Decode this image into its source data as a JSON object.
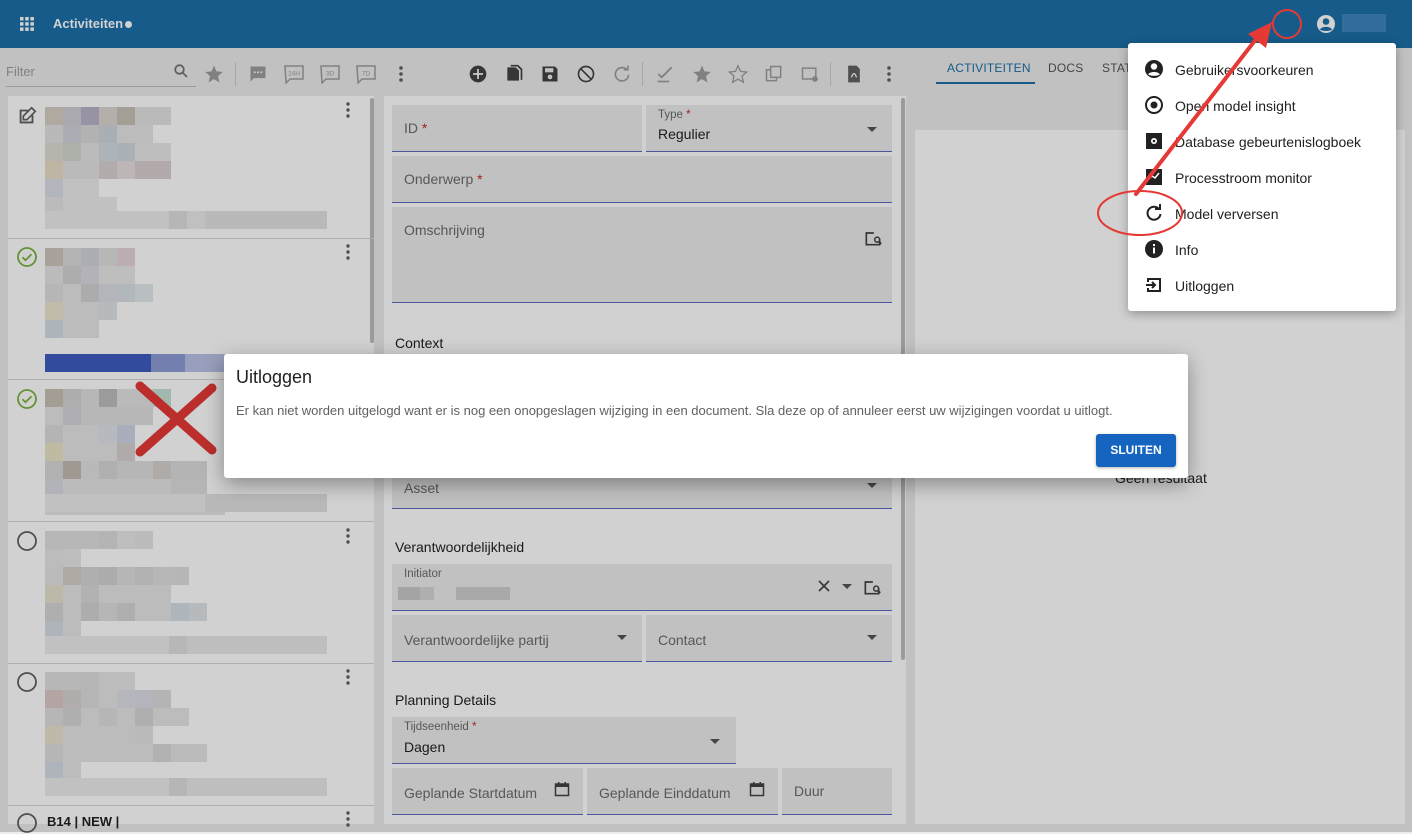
{
  "header": {
    "title": "Activiteiten"
  },
  "filter": {
    "placeholder": "Filter"
  },
  "tabs": [
    {
      "label": "ACTIVITEITEN",
      "active": true
    },
    {
      "label": "DOCS",
      "active": false
    },
    {
      "label": "STAT",
      "active": false
    }
  ],
  "list": {
    "last_item_text": "B14 | NEW |"
  },
  "form": {
    "id_label": "ID",
    "type_label": "Type",
    "type_value": "Regulier",
    "onderwerp_label": "Onderwerp",
    "omschrijving_label": "Omschrijving",
    "context_heading": "Context",
    "asset_label": "Asset",
    "verantwoordelijkheid_heading": "Verantwoordelijkheid",
    "initiator_label": "Initiator",
    "partij_label": "Verantwoordelijke partij",
    "contact_label": "Contact",
    "planning_heading": "Planning Details",
    "tijdseenheid_label": "Tijdseenheid",
    "tijdseenheid_value": "Dagen",
    "startdatum_label": "Geplande Startdatum",
    "einddatum_label": "Geplande Einddatum",
    "duur_label": "Duur",
    "required_mark": "*"
  },
  "right_panel": {
    "empty_text": "Geen resultaat"
  },
  "user_menu": {
    "items": [
      {
        "label": "Gebruikersvoorkeuren",
        "icon": "account-circle-icon"
      },
      {
        "label": "Open model insight",
        "icon": "model-insight-icon"
      },
      {
        "label": "Database gebeurtenislogboek",
        "icon": "database-log-icon"
      },
      {
        "label": "Processtroom monitor",
        "icon": "process-monitor-icon"
      },
      {
        "label": "Model verversen",
        "icon": "refresh-icon"
      },
      {
        "label": "Info",
        "icon": "info-icon"
      },
      {
        "label": "Uitloggen",
        "icon": "logout-icon"
      }
    ]
  },
  "dialog": {
    "title": "Uitloggen",
    "message": "Er kan niet worden uitgelogd want er is nog een onopgeslagen wijziging in een document. Sla deze op of annuleer eerst uw wijzigingen voordat u uitlogt.",
    "close_button": "SLUITEN"
  },
  "colors": {
    "topbar": "#1b6fa8",
    "primary_button": "#1565c0",
    "annotation_red": "#e53935",
    "check_green": "#7cb342",
    "field_underline": "#5d6cc0"
  }
}
